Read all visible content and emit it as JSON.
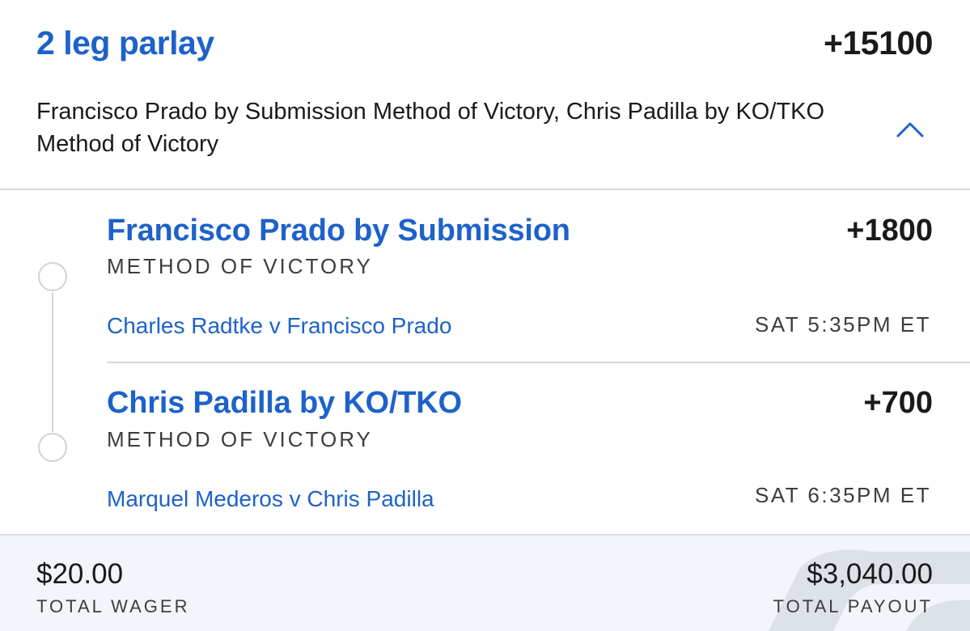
{
  "header": {
    "title": "2 leg parlay",
    "total_odds": "+15100",
    "summary": "Francisco Prado by Submission Method of Victory, Chris Padilla by KO/TKO Method of Victory",
    "collapse_icon": "chevron-up-icon"
  },
  "legs": [
    {
      "selection": "Francisco Prado by Submission",
      "odds": "+1800",
      "market": "METHOD OF VICTORY",
      "event": "Charles Radtke v Francisco Prado",
      "time": "SAT 5:35PM ET"
    },
    {
      "selection": "Chris Padilla by KO/TKO",
      "odds": "+700",
      "market": "METHOD OF VICTORY",
      "event": "Marquel Mederos v Chris Padilla",
      "time": "SAT 6:35PM ET"
    }
  ],
  "footer": {
    "wager_amount": "$20.00",
    "wager_label": "TOTAL WAGER",
    "payout_amount": "$3,040.00",
    "payout_label": "TOTAL PAYOUT"
  },
  "colors": {
    "accent": "#1e62c9",
    "text": "#1a1a1a",
    "footer_bg": "#f2f6fa",
    "divider": "#d6d9de"
  }
}
